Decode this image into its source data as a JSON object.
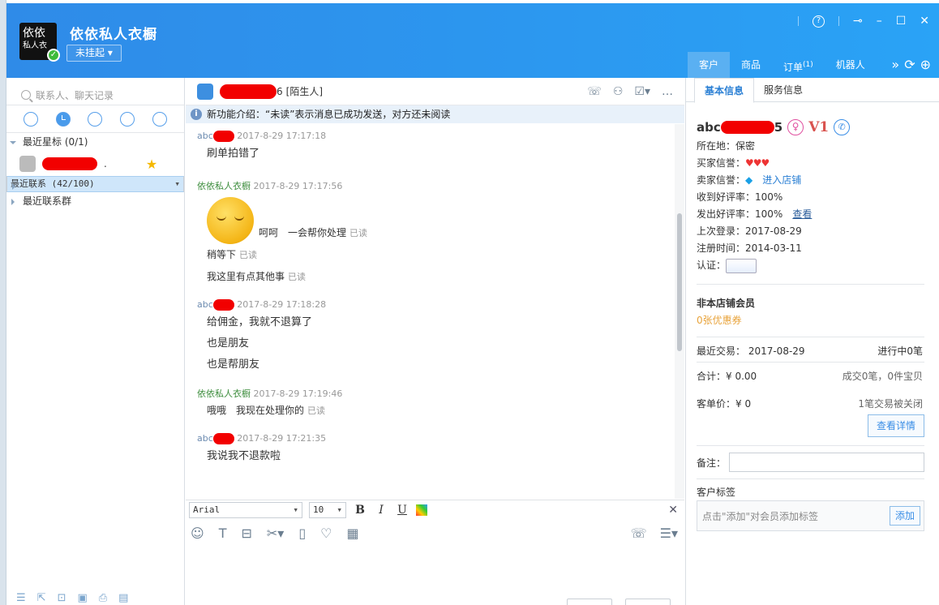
{
  "header": {
    "logo_line1": "依依",
    "logo_line2": "私人衣",
    "shop_name": "依依私人衣橱",
    "status": "未挂起",
    "right_tabs": [
      "客户",
      "商品",
      "订单",
      "机器人"
    ],
    "order_badge": "(1)"
  },
  "sidebar": {
    "search_placeholder": "联系人、聊天记录",
    "sections": [
      {
        "label": "最近星标 (0/1)"
      },
      {
        "label": "最近联系 (42/100)"
      },
      {
        "label": "最近联系群"
      }
    ],
    "contact_suffix": "."
  },
  "chat": {
    "name_suffix": "6",
    "stranger_tag": "[陌生人]",
    "notice": "新功能介绍：“未读”表示消息已成功发送，对方还未阅读",
    "read_label": "已读",
    "buyer_prefix": "abc",
    "seller_name": "依依私人衣橱",
    "messages": [
      {
        "time": "2017-8-29 17:17:18",
        "lines": [
          "刷单拍错了"
        ]
      },
      {
        "time": "2017-8-29 17:17:56",
        "lines": [
          "呵呵　一会帮你处理",
          "稍等下",
          "我这里有点其他事"
        ]
      },
      {
        "time": "2017-8-29 17:18:28",
        "lines": [
          "给佣金，我就不退算了",
          "也是朋友",
          "也是帮朋友"
        ]
      },
      {
        "time": "2017-8-29 17:19:46",
        "lines": [
          "哦哦　我现在处理你的"
        ]
      },
      {
        "time": "2017-8-29 17:21:35",
        "lines": [
          "我说我不退款啦"
        ]
      }
    ],
    "font_name": "Arial",
    "font_size": "10"
  },
  "customer": {
    "tabs": [
      "基本信息",
      "服务信息"
    ],
    "name_prefix": "abc",
    "name_suffix": "5",
    "vip": "V1",
    "location_label": "所在地：",
    "location": "保密",
    "buyer_credit_label": "买家信誉：",
    "seller_credit_label": "卖家信誉：",
    "enter_shop": "进入店铺",
    "received_rate": "收到好评率：100%",
    "given_rate": "发出好评率：100%",
    "view": "查看",
    "last_login": "上次登录：2017-08-29",
    "register": "注册时间：2014-03-11",
    "auth_label": "认证：",
    "member": "非本店铺会员",
    "coupon": "0张优惠券",
    "recent_trade": "最近交易： 2017-08-29",
    "in_progress": "进行中0笔",
    "total": "合计：¥ 0.00",
    "deals": "成交0笔，0件宝贝",
    "unit_price": "客单价：¥ 0",
    "closed": "1笔交易被关闭",
    "detail_btn": "查看详情",
    "remark_label": "备注：",
    "tags_title": "客户标签",
    "tags_hint": "点击\"添加\"对会员添加标签",
    "add_btn": "添加"
  }
}
